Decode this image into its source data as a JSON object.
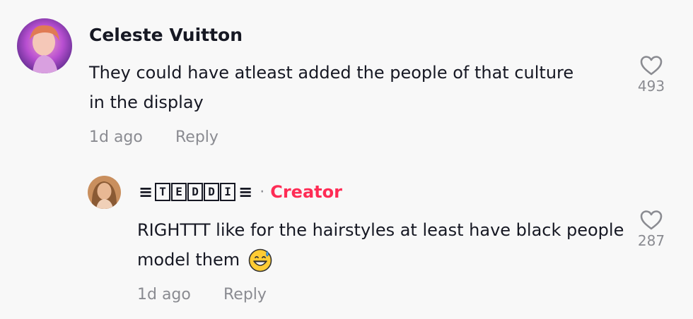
{
  "comments": [
    {
      "username": "Celeste Vuitton",
      "text": "They could have atleast added the people of that culture in the display",
      "age": "1d ago",
      "reply_label": "Reply",
      "likes": "493"
    }
  ],
  "reply": {
    "username_prefix": "≡",
    "username_letters": [
      "T",
      "E",
      "D",
      "D",
      "I"
    ],
    "username_suffix": "≡",
    "separator": "·",
    "badge": "Creator",
    "text": "RIGHTTT like for the hairstyles at least have black people model them",
    "emoji": "grinning-face-with-sweat",
    "age": "1d ago",
    "reply_label": "Reply",
    "likes": "287"
  },
  "colors": {
    "background": "#f8f8f8",
    "text": "#161823",
    "muted": "#8a8b91",
    "creator": "#fe2c55"
  }
}
